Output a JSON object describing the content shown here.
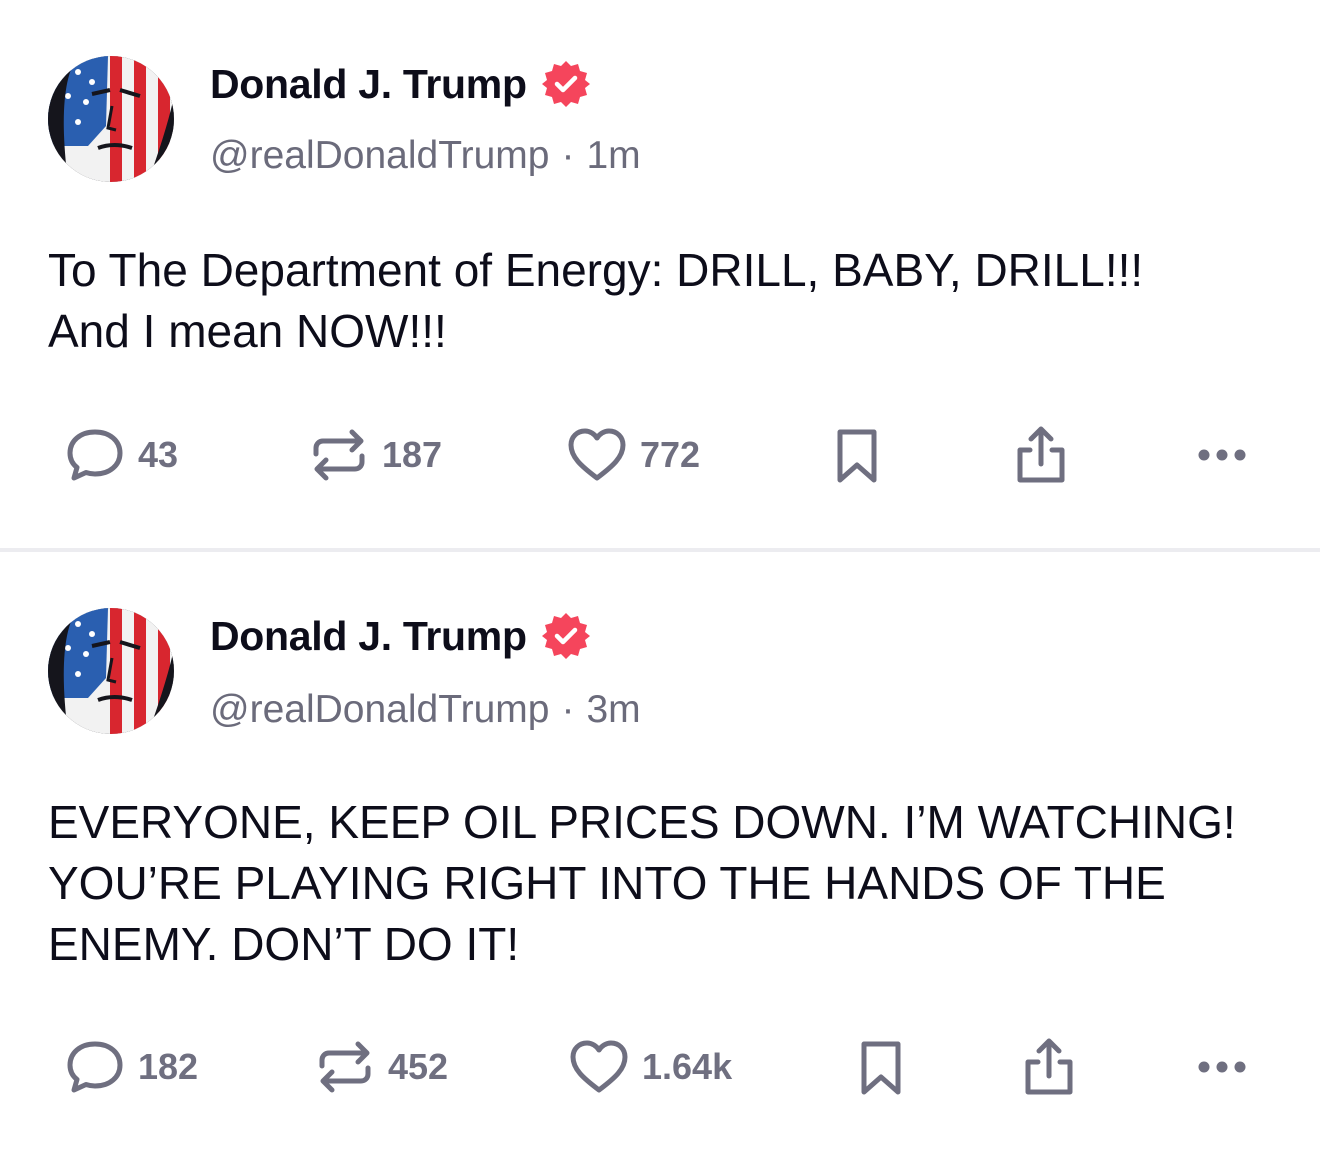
{
  "posts": [
    {
      "author": {
        "name": "Donald J. Trump",
        "handle": "@realDonaldTrump",
        "verified": true,
        "avatar_icon": "flag-face-avatar"
      },
      "time": "1m",
      "text": "To The Department of Energy: DRILL, BABY, DRILL!!!\nAnd I mean NOW!!!",
      "actions": {
        "replies": "43",
        "reposts": "187",
        "likes": "772"
      }
    },
    {
      "author": {
        "name": "Donald J. Trump",
        "handle": "@realDonaldTrump",
        "verified": true,
        "avatar_icon": "flag-face-avatar"
      },
      "time": "3m",
      "text": "EVERYONE, KEEP OIL PRICES DOWN. I’M WATCHING!\nYOU’RE PLAYING RIGHT INTO THE HANDS OF THE\nENEMY. DON’T DO IT!",
      "actions": {
        "replies": "182",
        "reposts": "452",
        "likes": "1.64k"
      }
    }
  ],
  "colors": {
    "verified_badge": "#f5455c",
    "text_primary": "#0d0d1a",
    "text_secondary": "#6b6b7b",
    "icon_gray": "#6f6f80",
    "divider": "#ececf0",
    "flag_red": "#d8262f",
    "flag_blue": "#2a5fb0"
  },
  "icons": {
    "reply": "speech-bubble-icon",
    "repost": "repost-arrows-icon",
    "like": "heart-icon",
    "bookmark": "bookmark-icon",
    "share": "share-icon",
    "more": "more-dots-icon",
    "verified": "verified-badge-icon"
  }
}
